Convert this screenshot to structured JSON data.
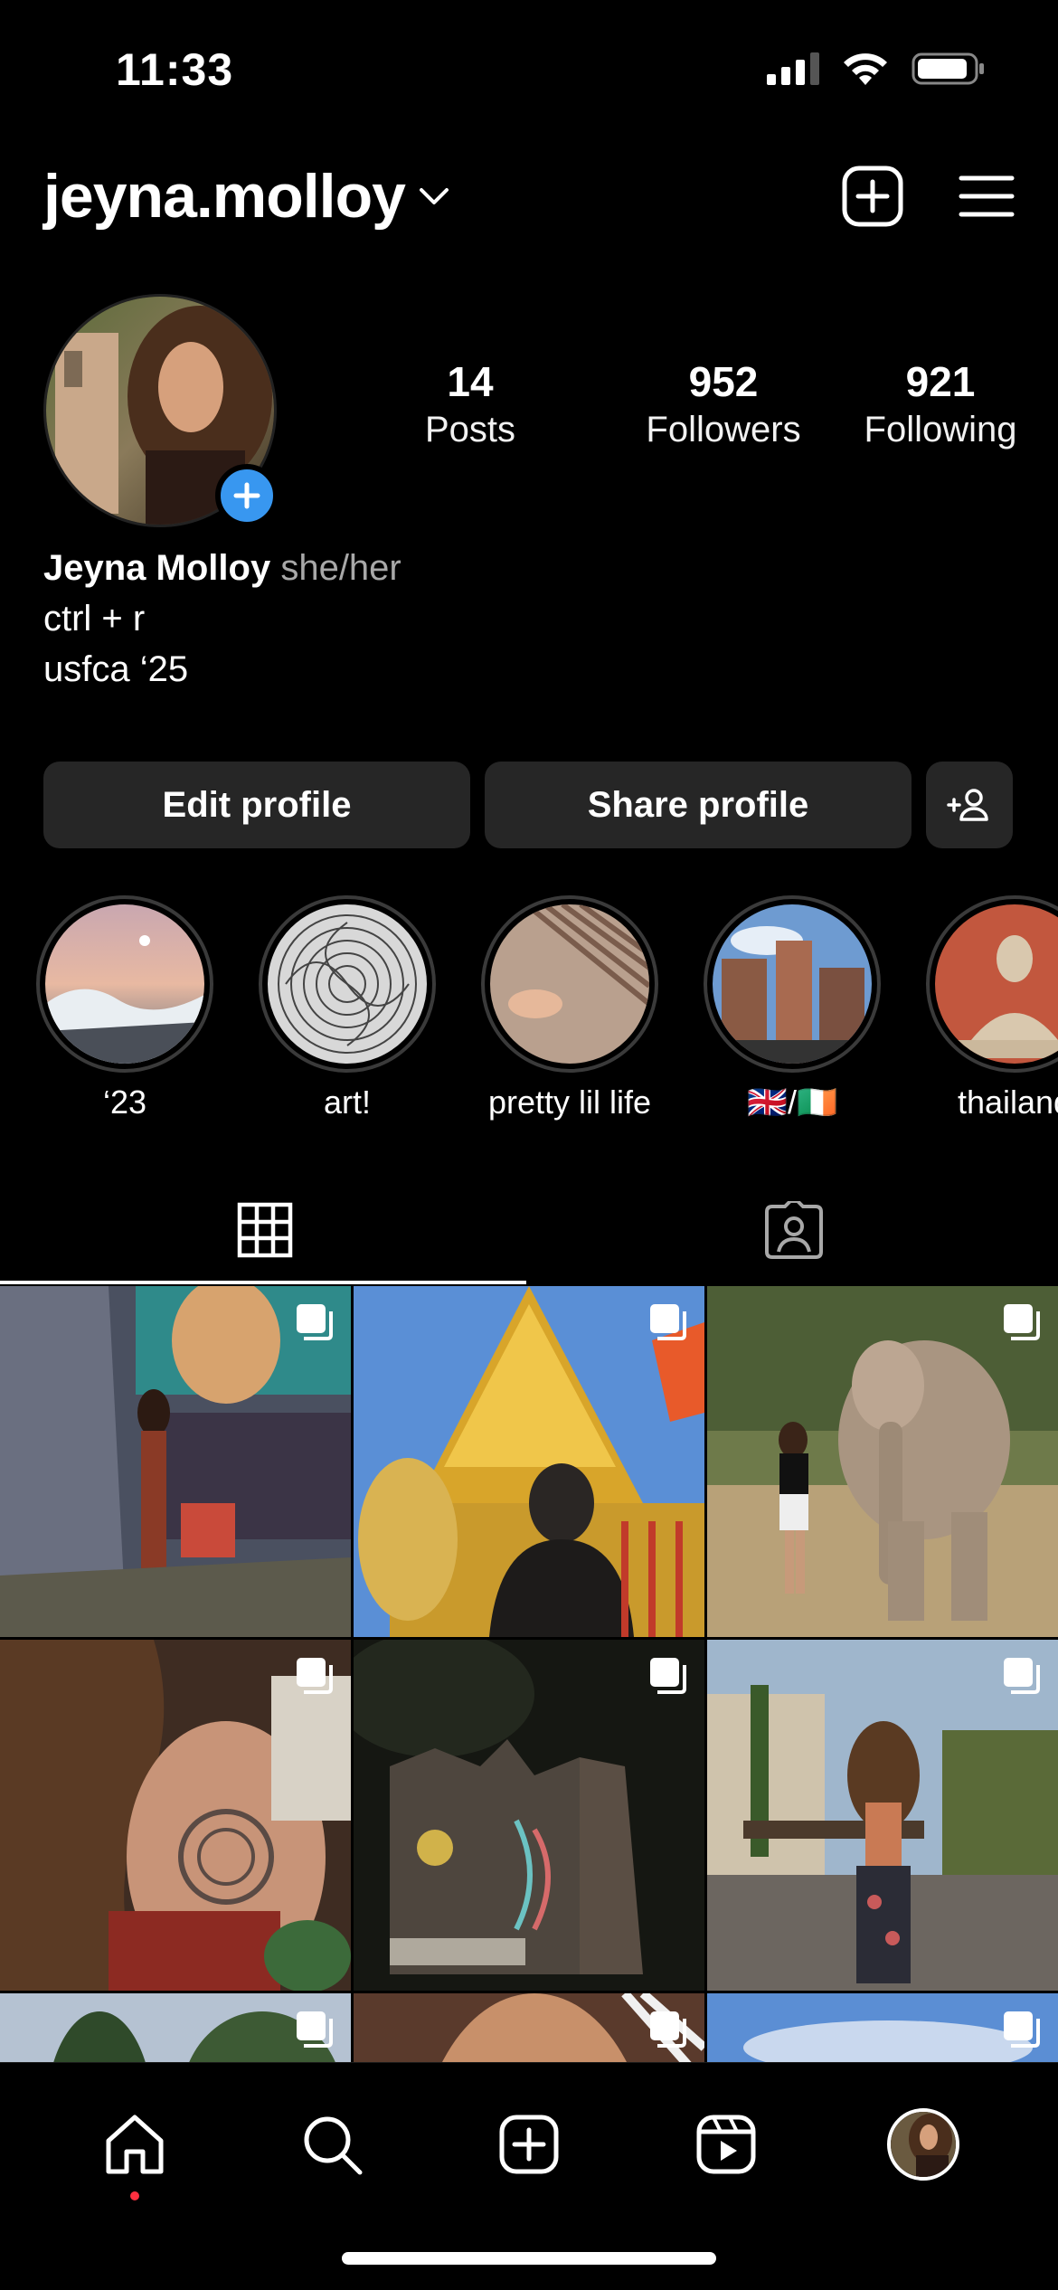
{
  "status_bar": {
    "time": "11:33"
  },
  "header": {
    "username": "jeyna.molloy"
  },
  "profile": {
    "stats": [
      {
        "value": "14",
        "label": "Posts"
      },
      {
        "value": "952",
        "label": "Followers"
      },
      {
        "value": "921",
        "label": "Following"
      }
    ],
    "name": "Jeyna Molloy",
    "pronouns": "she/her",
    "bio_line1": "ctrl + r",
    "bio_line2": "usfca ‘25"
  },
  "buttons": {
    "edit": "Edit profile",
    "share": "Share profile"
  },
  "highlights": [
    {
      "label": "‘23"
    },
    {
      "label": "art!"
    },
    {
      "label": "pretty lil life"
    },
    {
      "label": "🇬🇧/🇮🇪"
    },
    {
      "label": "thailand"
    }
  ],
  "icons": {
    "chevron": "chevron-down-icon",
    "new_post": "plus-square-icon",
    "menu": "hamburger-menu-icon",
    "grid_tab": "grid-icon",
    "tagged_tab": "tagged-person-icon",
    "multi_photo": "carousel-icon",
    "nav": [
      "home-icon",
      "search-icon",
      "create-icon",
      "reels-icon",
      "profile-avatar"
    ]
  },
  "colors": {
    "accent": "#3897f0",
    "notification": "#ff3040",
    "button_bg": "#262626"
  }
}
